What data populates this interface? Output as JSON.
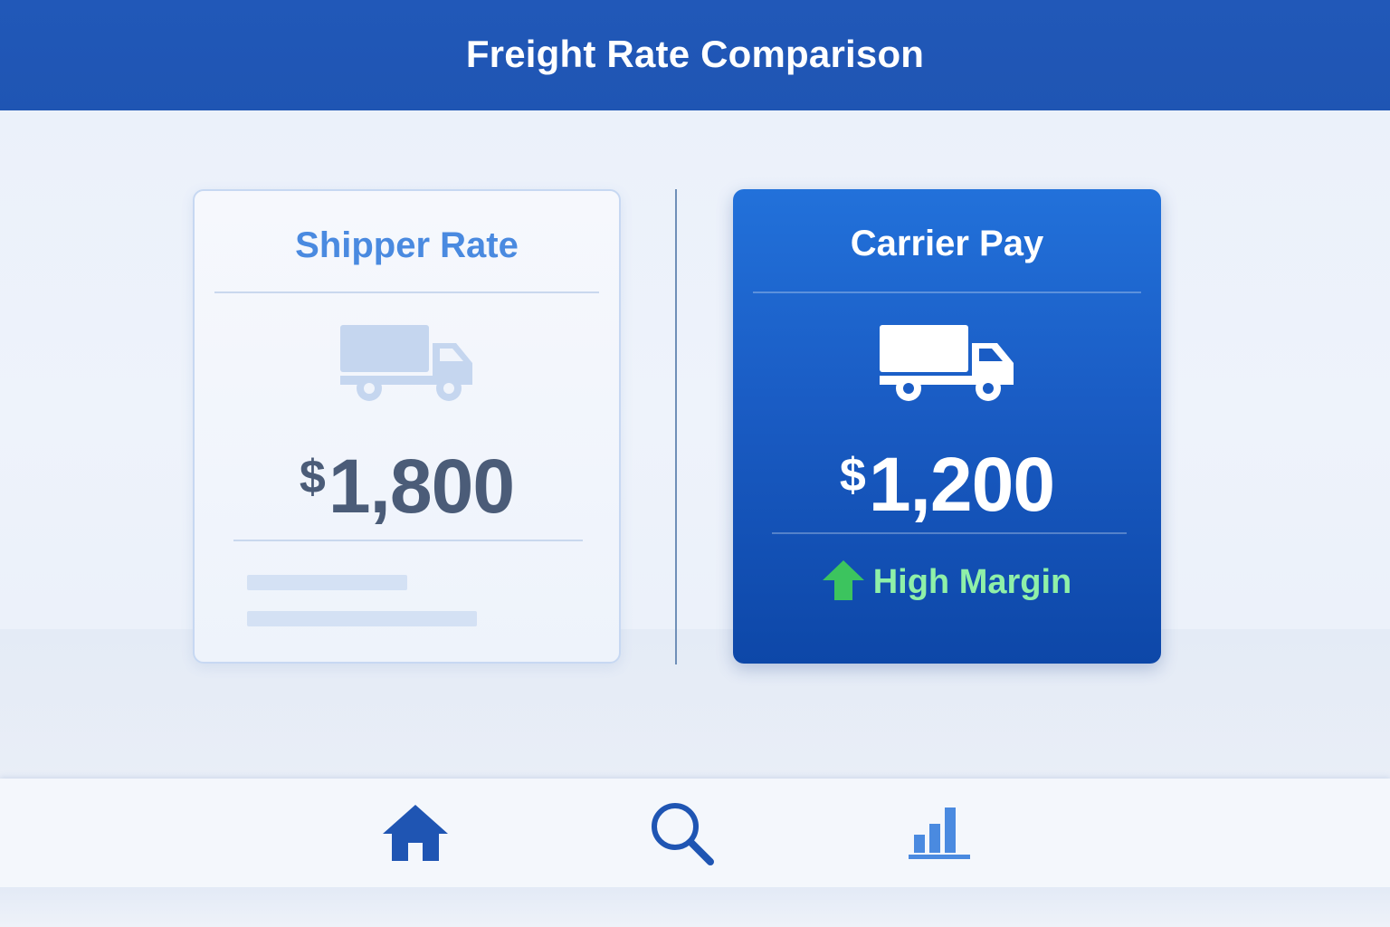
{
  "header": {
    "title": "Freight Rate Comparison"
  },
  "cards": {
    "shipper": {
      "title": "Shipper Rate",
      "currency": "$",
      "amount": "1,800"
    },
    "carrier": {
      "title": "Carrier Pay",
      "currency": "$",
      "amount": "1,200",
      "badge": "High Margin"
    }
  },
  "icons": {
    "truck": "truck-icon",
    "arrow": "arrow-up-icon",
    "home": "home-icon",
    "search": "search-icon",
    "stats": "bar-chart-icon"
  },
  "colors": {
    "header": "#1f55b3",
    "accent": "#4a8ae0",
    "carrier_card": "#1a5cc4",
    "margin_text": "#8ff0a8",
    "margin_arrow": "#3cc45e"
  }
}
